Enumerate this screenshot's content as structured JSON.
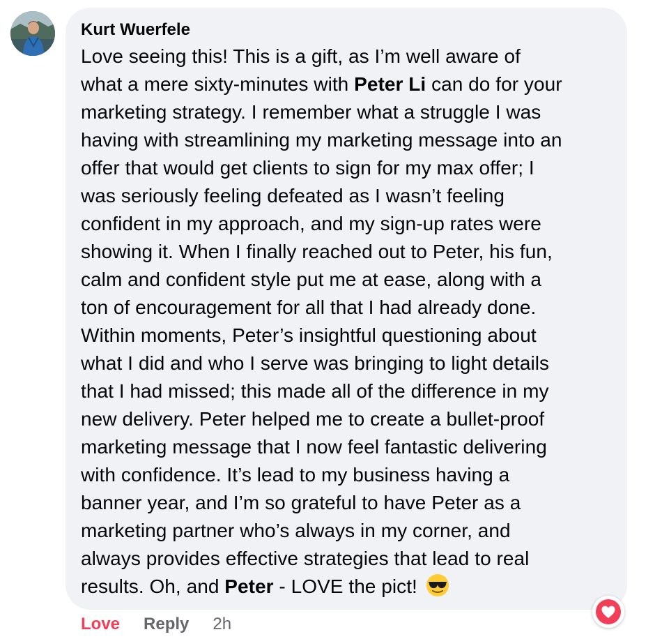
{
  "comment": {
    "author": "Kurt Wuerfele",
    "lines": [
      [
        "Love seeing this! This is a gift, as I’m well aware of"
      ],
      [
        "what a mere sixty-minutes with ",
        {
          "b": "Peter Li"
        },
        " can do for your"
      ],
      [
        "marketing strategy. I remember what a struggle I was"
      ],
      [
        "having with streamlining my marketing message into an"
      ],
      [
        "offer that would get clients to sign for my max offer; I"
      ],
      [
        "was seriously feeling defeated as I wasn’t feeling"
      ],
      [
        "confident in my approach, and my sign-up rates were"
      ],
      [
        "showing it. When I finally reached out to Peter, his fun,"
      ],
      [
        "calm and confident style put me at ease, along with a"
      ],
      [
        "ton of encouragement for all that I had already done."
      ],
      [
        "Within moments, Peter’s insightful questioning about"
      ],
      [
        "what I did and who I serve was bringing to light details"
      ],
      [
        "that I had missed; this made all of the difference in my"
      ],
      [
        "new delivery. Peter helped me to create a bullet-proof"
      ],
      [
        "marketing message that I now feel fantastic delivering"
      ],
      [
        "with confidence. It’s lead to my business having a"
      ],
      [
        "banner year, and I’m so grateful to have Peter as a"
      ],
      [
        "marketing partner who’s always in my corner, and"
      ],
      [
        "always provides effective strategies that lead to real"
      ],
      [
        "results. Oh, and ",
        {
          "b": "Peter"
        },
        " - LOVE the pict! ",
        {
          "emoji": "smiling-face-with-sunglasses"
        }
      ]
    ]
  },
  "actions": {
    "love_label": "Love",
    "reply_label": "Reply",
    "time": "2h"
  },
  "reaction": {
    "type": "love",
    "color": "#f33e58"
  },
  "colors": {
    "bubble": "#f0f2f5",
    "text": "#050505",
    "secondary": "#65676b",
    "love": "#f33e58"
  }
}
